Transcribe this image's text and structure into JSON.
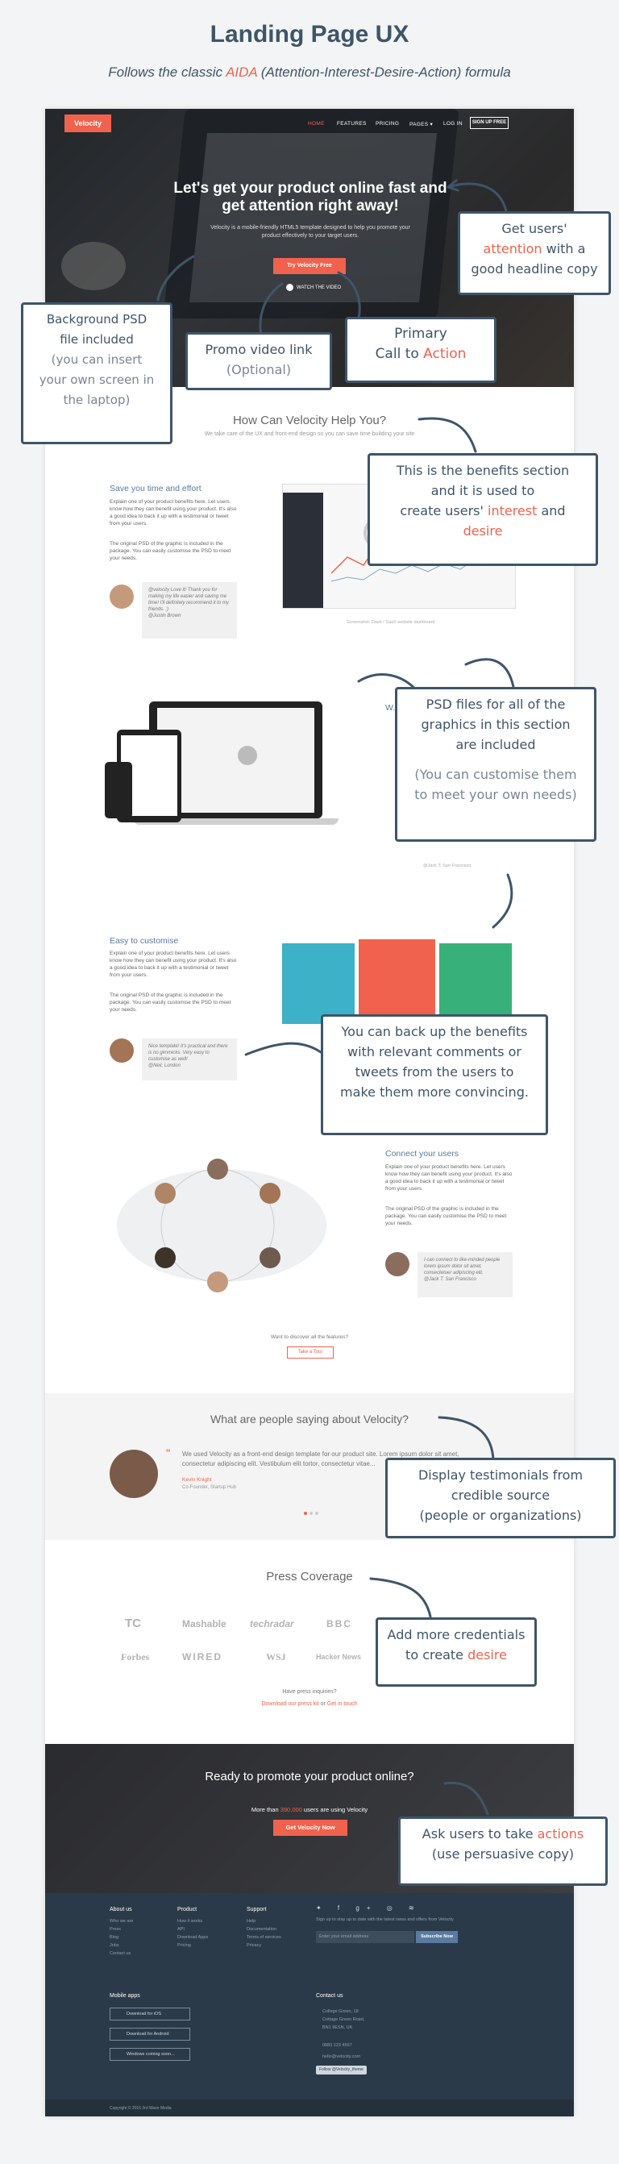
{
  "header": {
    "title": "Landing Page UX",
    "subtitle_pre": "Follows the classic ",
    "subtitle_accent": "AIDA",
    "subtitle_post": " (Attention-Interest-Desire-Action) formula"
  },
  "nav": {
    "logo": "Velocity",
    "items": [
      "HOME",
      "FEATURES",
      "PRICING",
      "PAGES ▾",
      "LOG IN"
    ],
    "signup": "SIGN UP FREE"
  },
  "hero": {
    "headline": "Let's get your product online fast and get attention right away!",
    "text": "Velocity is a mobile-friendly HTML5 template designed to help you promote your product effectively to your target users.",
    "cta": "Try Velocity Free",
    "watch": "WATCH THE VIDEO"
  },
  "help": {
    "title": "How Can Velocity Help You?",
    "subtitle": "We take care of the UX and front-end design so you can save time building your site"
  },
  "feature1": {
    "title": "Save you time and effort",
    "p1": "Explain one of your product benefits here. Let users know how they can benefit using your product. It's also a good idea to back it up with a testimonial or tweet from your users.",
    "p2": "The original PSD of the graphic is included in the package. You can easily customise the PSD to meet your needs.",
    "quote": "@velocity Love it! Thank you for making my life easier and saving me time! I'll definitely recommend it to my friends. :)",
    "quote_author": "@Justin Brown",
    "caption": "Screenshot: Dash / SaaS website dashboard"
  },
  "feature2": {
    "title": "W...",
    "quote_author": "@Jack T. San Francisco"
  },
  "feature3": {
    "title": "Easy to customise",
    "p1": "Explain one of your product benefits here. Let users know how they can benefit using your product. It's also a good idea to back it up with a testimonial or tweet from your users.",
    "p2": "The original PSD of the graphic is included in the package. You can easily customise the PSD to meet your needs.",
    "quote": "Nice template! It's practical and there is no gimmicks. Very easy to customise as well!",
    "quote_author": "@Neil, London"
  },
  "feature4": {
    "title": "Connect your users",
    "p1": "Explain one of your product benefits here. Let users know how they can benefit using your product. It's also a good idea to back it up with a testimonial or tweet from your users.",
    "p2": "The original PSD of the graphic is included in the package. You can easily customise the PSD to meet your needs.",
    "quote": "I can connect to like-minded people lorem ipsum dolor sit amet, consectetuer adipiscing elit.",
    "quote_author": "@Jack T. San Francisco"
  },
  "discover": {
    "text": "Want to discover all the features?",
    "button": "Take a Tour"
  },
  "testimonials": {
    "title": "What are people saying about Velocity?",
    "quote": "We used Velocity as a front-end design template for our product site. Lorem ipsum dolor sit amet, consectetur adipiscing elit. Vestibulum elit tortor, consectetur vitae...",
    "author": "Kevin Knight",
    "role": "Co-Founder, Startup Hub"
  },
  "press": {
    "title": "Press Coverage",
    "logos": [
      "TC",
      "Mashable",
      "techradar",
      "BBC",
      "Forbes",
      "WIRED",
      "WSJ",
      "Hacker News"
    ],
    "inquiry": "Have press inquiries?",
    "download_link": "Download our press kit",
    "or": " or ",
    "touch_link": "Get in touch"
  },
  "cta": {
    "title": "Ready to promote your product online?",
    "text_pre": "More than ",
    "text_accent": "390,000",
    "text_post": " users are using Velocity",
    "button": "Get Velocity Now"
  },
  "footer": {
    "col1": {
      "title": "About us",
      "links": [
        "Who we are",
        "Press",
        "Blog",
        "Jobs",
        "Contact us"
      ]
    },
    "col2": {
      "title": "Product",
      "links": [
        "How it works",
        "API",
        "Download Apps",
        "Pricing"
      ]
    },
    "col3": {
      "title": "Support",
      "links": [
        "Help",
        "Documentation",
        "Terms of services",
        "Privacy"
      ]
    },
    "social_text": "Sign up to stay up to date with the latest news and offers from Velocity",
    "email_placeholder": "Enter your email address",
    "subscribe": "Subscribe Now",
    "mobile_title": "Mobile apps",
    "apps": [
      "Download for iOS",
      "Download for Android",
      "Windows coming soon..."
    ],
    "contact_title": "Contact us",
    "address": "College Green, 18 Cottage Green Road, BN1 9ESN, UK",
    "phone": "0883 123 4567",
    "email": "hello@velocity.com",
    "follow": "Follow @Velocity_theme",
    "copyright": "Copyright © 2016 3rd Wave Media"
  },
  "notes": {
    "attention": {
      "l1": "Get users'",
      "accent": "attention",
      "l2": " with a",
      "l3": "good headline copy"
    },
    "psd": {
      "l1": "Background PSD",
      "l2": "file included",
      "l3": "(you can insert",
      "l4": "your own screen in",
      "l5": "the laptop)"
    },
    "video": {
      "l1": "Promo video link",
      "l2": "(Optional)"
    },
    "primary": {
      "l1": "Primary",
      "l2": "Call to ",
      "accent": "Action"
    },
    "benefits": {
      "l1": "This is the benefits section",
      "l2": "and it is used to",
      "l3": "create users' ",
      "accent1": "interest",
      "l3b": " and",
      "accent2": "desire"
    },
    "psd_graphics": {
      "l1": "PSD files for all of the",
      "l2": "graphics in this section",
      "l3": "are included",
      "l4": "(You can customise them",
      "l5": "to meet your own needs)"
    },
    "backup": {
      "l1": "You can back up the benefits",
      "l2": "with relevant comments or",
      "l3": "tweets from the users to",
      "l4": "make them more convincing."
    },
    "testimonials": {
      "l1": "Display testimonials from",
      "l2": "credible source",
      "l3": "(people or organizations)"
    },
    "credentials": {
      "l1": "Add more credentials",
      "l2": "to create ",
      "accent": "desire"
    },
    "actions": {
      "l1": "Ask users to take ",
      "accent": "actions",
      "l2": "(use persuasive copy)"
    }
  },
  "colors": {
    "accent": "#f0624d",
    "ink": "#3e5569",
    "footer": "#2b3a48"
  }
}
